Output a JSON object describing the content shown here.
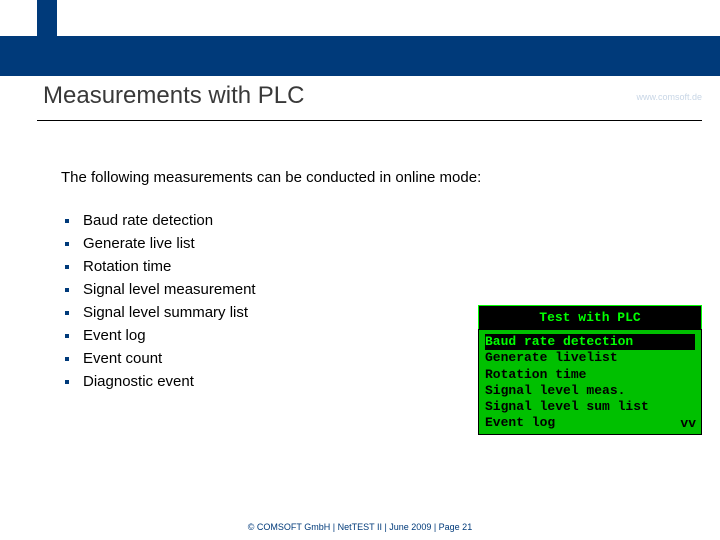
{
  "brand": {
    "name": "COMSOFT",
    "url": "www.comsoft.de"
  },
  "title": "Measurements with PLC",
  "intro": "The following measurements can be conducted in online mode:",
  "bullets": [
    "Baud rate detection",
    "Generate live list",
    "Rotation time",
    "Signal level measurement",
    "Signal level summary list",
    "Event log",
    "Event count",
    "Diagnostic event"
  ],
  "screen": {
    "title": "Test with PLC",
    "rows": [
      "Baud rate detection",
      "Generate livelist",
      "Rotation time",
      "Signal level meas.",
      "Signal level sum list",
      "Event log"
    ],
    "arrows": "vv"
  },
  "footer": "© COMSOFT GmbH | NetTEST II | June 2009 | Page 21"
}
